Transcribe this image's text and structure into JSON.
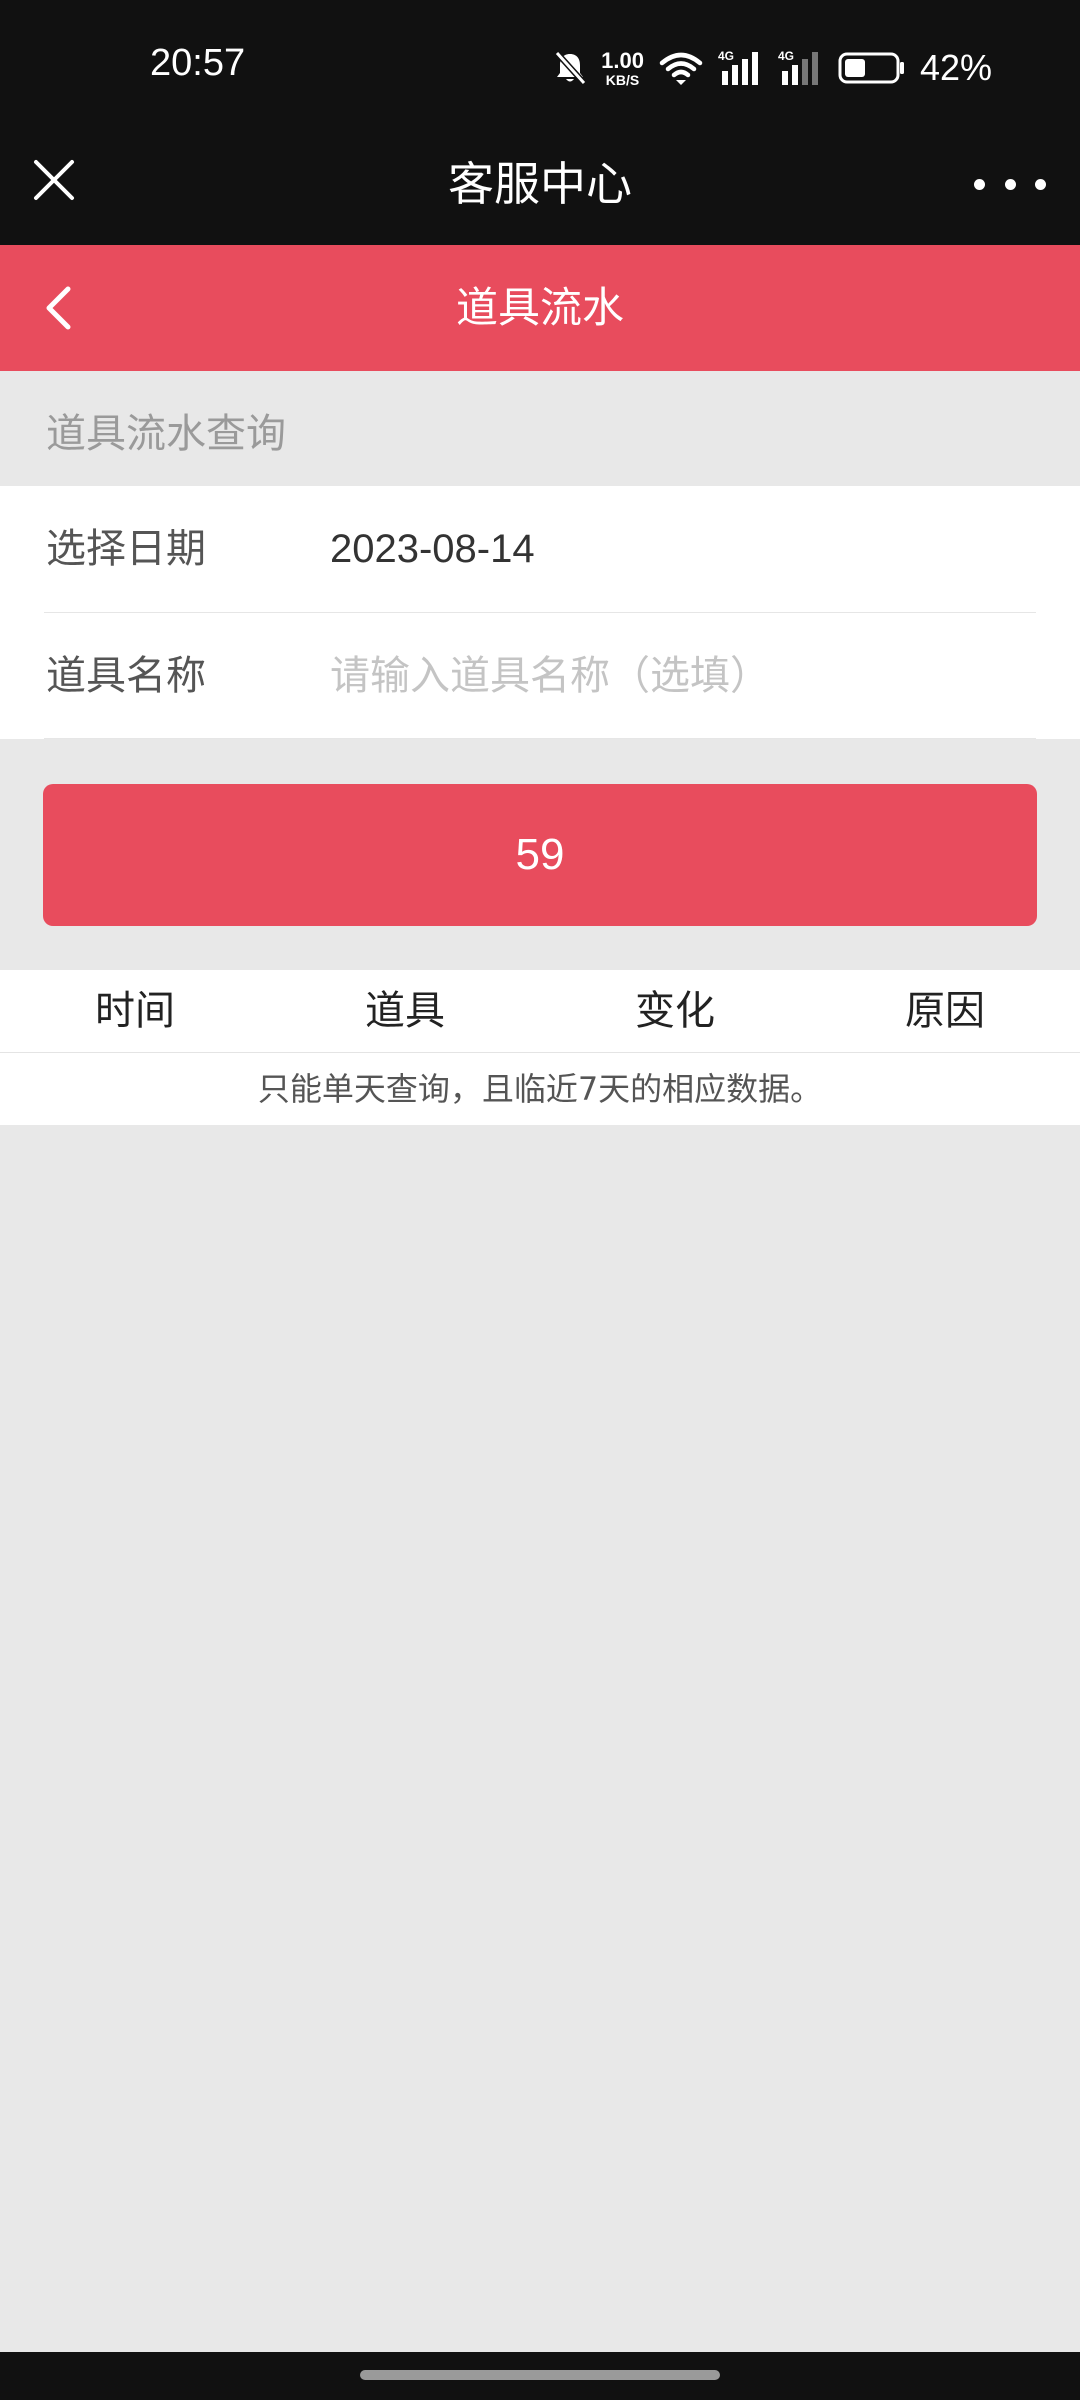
{
  "status_bar": {
    "time": "20:57",
    "network_speed_value": "1.00",
    "network_speed_unit": "KB/S",
    "signal_1_label": "4G",
    "signal_2_label": "4G",
    "battery_percent": "42%",
    "battery_level": 0.42,
    "icons": [
      "bell-muted-icon",
      "wifi-icon",
      "signal-icon",
      "battery-icon"
    ]
  },
  "title_bar": {
    "title": "客服中心",
    "icons": [
      "close-icon",
      "more-icon"
    ]
  },
  "page_header": {
    "title": "道具流水",
    "icons": [
      "back-icon"
    ]
  },
  "section": {
    "title": "道具流水查询"
  },
  "form": {
    "date_label": "选择日期",
    "date_value": "2023-08-14",
    "item_label": "道具名称",
    "item_placeholder": "请输入道具名称（选填）",
    "item_value": ""
  },
  "submit_button": {
    "label": "59"
  },
  "table": {
    "columns": [
      "时间",
      "道具",
      "变化",
      "原因"
    ],
    "note": "只能单天查询，且临近7天的相应数据。"
  },
  "colors": {
    "accent": "#e84c5d",
    "top_bar": "#111111",
    "background": "#e8e8e8"
  }
}
